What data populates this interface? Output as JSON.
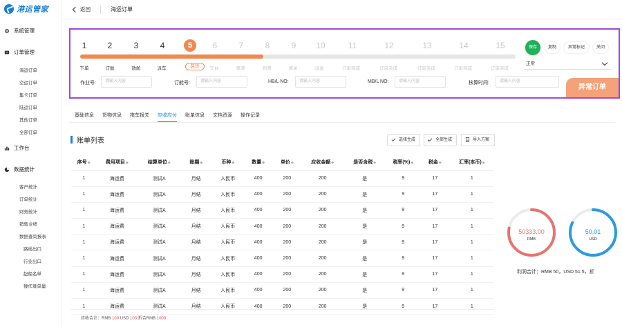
{
  "sidebar": {
    "logo_text": "港运管家",
    "groups": [
      {
        "label": "系统管理",
        "icon": "gear-icon"
      },
      {
        "label": "订单管理",
        "icon": "order-icon"
      },
      {
        "label": "工作台",
        "icon": "chart-icon"
      },
      {
        "label": "数据统计",
        "icon": "stats-icon"
      }
    ],
    "order_items": [
      "海运订单",
      "空运订单",
      "集卡订单",
      "陆运订单",
      "其他订单",
      "全部订单"
    ],
    "stats_items": [
      "客户统计",
      "订单统计",
      "财务统计",
      "销售业绩",
      "数据查询报表"
    ],
    "report_items": [
      "路线出口",
      "行业出口",
      "起船名单",
      "操作录单量"
    ]
  },
  "header": {
    "back_label": "返回",
    "title": "海运订单"
  },
  "progress": {
    "steps": [
      {
        "num": "1",
        "label": "下单"
      },
      {
        "num": "2",
        "label": "订舱"
      },
      {
        "num": "3",
        "label": "放舱"
      },
      {
        "num": "4",
        "label": "派车"
      },
      {
        "num": "5",
        "label": "装货"
      },
      {
        "num": "6",
        "label": "交台"
      },
      {
        "num": "7",
        "label": "离港"
      },
      {
        "num": "8",
        "label": "到港"
      },
      {
        "num": "9",
        "label": "清关"
      },
      {
        "num": "10",
        "label": "派送"
      },
      {
        "num": "11",
        "label": "订单完成"
      },
      {
        "num": "12",
        "label": "订单完成"
      },
      {
        "num": "13",
        "label": "订单完成"
      },
      {
        "num": "14",
        "label": "订单完成"
      },
      {
        "num": "15",
        "label": "订单完成"
      }
    ],
    "current_step": 5,
    "progress_fraction": 0.42,
    "buttons": {
      "save": "保存",
      "copy": "复制",
      "abnormal_mark": "异常标记",
      "close": "关闭"
    },
    "status_value": "正常",
    "fields": {
      "job_label": "作业号:",
      "booking_label": "订舱号:",
      "hbl_label": "HB/L NO:",
      "mbl_label": "MB/L NO:",
      "settle_time_label": "核算时间:",
      "placeholder": "请输入内容"
    },
    "abnormal_tag": "异常订单"
  },
  "tabs": [
    "基础信息",
    "货物信息",
    "拖车报关",
    "应收应付",
    "账单信息",
    "文档资源",
    "操作记录"
  ],
  "active_tab": 3,
  "bill": {
    "title": "账单列表",
    "actions": [
      "选择生成",
      "全部生成",
      "导入方案"
    ],
    "columns": [
      "序号",
      "费用项目",
      "结算单位",
      "账期",
      "币种",
      "数量",
      "单价",
      "应收金额",
      "是否含税",
      "税率(%)",
      "税金",
      "汇率(本币)"
    ],
    "sortable": [
      true,
      true,
      true,
      true,
      true,
      true,
      true,
      true,
      true,
      true,
      true,
      true
    ],
    "rows": [
      [
        "1",
        "海运费",
        "测试A",
        "月结",
        "人民币",
        "400",
        "200",
        "200",
        "是",
        "9",
        "17",
        "1"
      ],
      [
        "1",
        "海运费",
        "测试A",
        "月结",
        "人民币",
        "400",
        "200",
        "200",
        "是",
        "9",
        "17",
        "1"
      ],
      [
        "1",
        "海运费",
        "测试A",
        "月结",
        "人民币",
        "400",
        "200",
        "200",
        "是",
        "9",
        "17",
        "1"
      ],
      [
        "1",
        "海运费",
        "测试A",
        "月结",
        "人民币",
        "400",
        "200",
        "200",
        "是",
        "9",
        "17",
        "1"
      ],
      [
        "1",
        "海运费",
        "测试A",
        "月结",
        "人民币",
        "400",
        "200",
        "200",
        "是",
        "9",
        "17",
        "1"
      ],
      [
        "1",
        "海运费",
        "测试A",
        "月结",
        "人民币",
        "400",
        "200",
        "200",
        "是",
        "9",
        "17",
        "1"
      ],
      [
        "1",
        "海运费",
        "测试A",
        "月结",
        "人民币",
        "400",
        "200",
        "200",
        "是",
        "9",
        "17",
        "1"
      ],
      [
        "1",
        "海运费",
        "测试A",
        "月结",
        "人民币",
        "400",
        "200",
        "200",
        "是",
        "9",
        "17",
        "1"
      ],
      [
        "1",
        "海运费",
        "测试A",
        "月结",
        "人民币",
        "400",
        "200",
        "200",
        "是",
        "9",
        "17",
        "1"
      ]
    ],
    "footer": {
      "prefix": "应收合计：RMB ",
      "rmb": "100",
      "mid": " USD ",
      "usd": "103",
      "mid2": " 折合RMB ",
      "total": "1000"
    }
  },
  "summary": {
    "rmb_value": "50333.00",
    "rmb_unit": "RMB",
    "usd_value": "50.01",
    "usd_unit": "USD",
    "rmb_ring_fraction": 0.78,
    "usd_ring_fraction": 0.82,
    "profit_text": "利润合计：RMB 50，USD 51.5，折",
    "colors": {
      "rmb": "#e8736e",
      "usd": "#2b9be0",
      "accent": "#f0894f",
      "primary": "#1a7fd6",
      "save": "#1fb25a"
    }
  }
}
